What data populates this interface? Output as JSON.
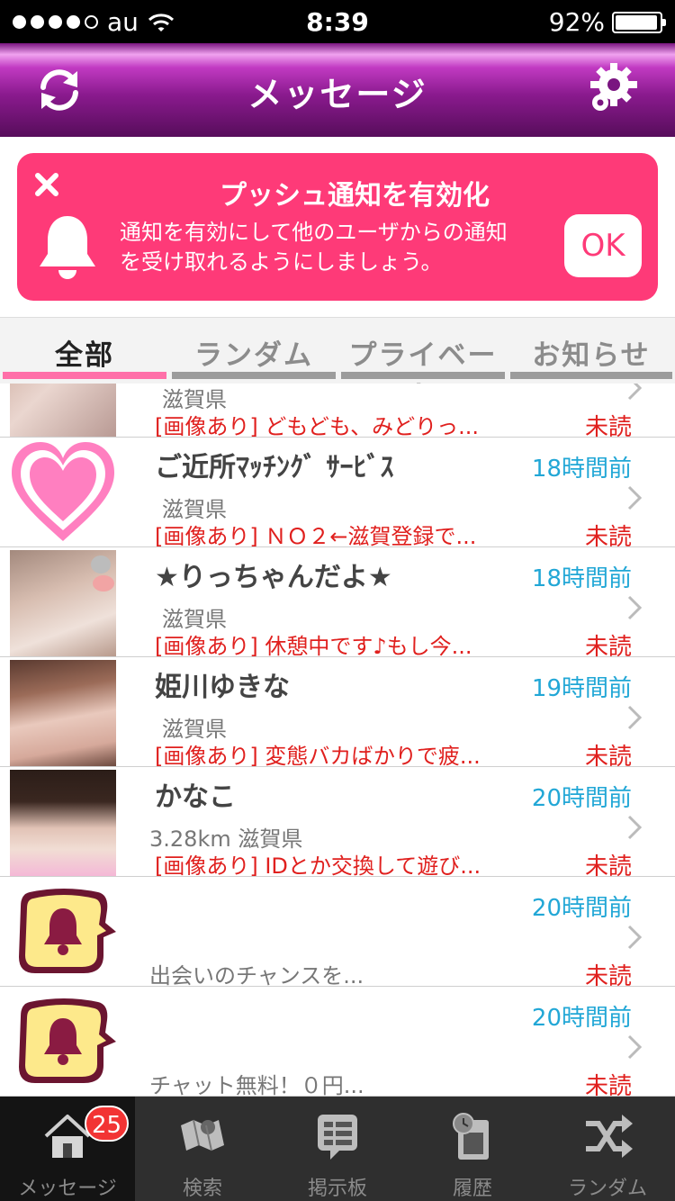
{
  "status_bar": {
    "carrier": "au",
    "time": "8:39",
    "battery": "92%"
  },
  "header": {
    "title": "メッセージ"
  },
  "banner": {
    "title": "プッシュ通知を有効化",
    "text_line1": "通知を有効にして他のユーザからの通知",
    "text_line2": "を受け取れるようにしましょう。",
    "ok_label": "OK"
  },
  "tabs": [
    {
      "label": "全部",
      "active": true
    },
    {
      "label": "ランダム",
      "active": false
    },
    {
      "label": "プライベート",
      "active": false
    },
    {
      "label": "お知らせ",
      "active": false
    }
  ],
  "messages": [
    {
      "name": "",
      "time": "",
      "location": "滋賀県",
      "preview": "[画像あり] どもども、みどりっ...",
      "status": "未読"
    },
    {
      "name": "ご近所ﾏｯﾁﾝｸﾞ ｻｰﾋﾞｽ",
      "time": "18時間前",
      "location": "滋賀県",
      "preview": "[画像あり] ＮＯ２←滋賀登録で...",
      "status": "未読"
    },
    {
      "name": "★りっちゃんだよ★",
      "time": "18時間前",
      "location": "滋賀県",
      "preview": "[画像あり] 休憩中です♪もし今...",
      "status": "未読"
    },
    {
      "name": "姫川ゆきな",
      "time": "19時間前",
      "location": "滋賀県",
      "preview": "[画像あり] 変態バカばかりで疲...",
      "status": "未読"
    },
    {
      "name": "かなこ",
      "time": "20時間前",
      "location": "3.28km  滋賀県",
      "preview": "[画像あり] IDとか交換して遊び...",
      "status": "未読"
    },
    {
      "name": "",
      "time": "20時間前",
      "location": "",
      "preview": "出会いのチャンスを...",
      "status": "未読"
    },
    {
      "name": "",
      "time": "20時間前",
      "location": "",
      "preview": "チャット無料！０円...",
      "status": "未読"
    }
  ],
  "tab_bar": {
    "items": [
      {
        "label": "メッセージ",
        "icon": "home-icon",
        "active": true
      },
      {
        "label": "検索",
        "icon": "map-icon",
        "active": false
      },
      {
        "label": "掲示板",
        "icon": "bulletin-board-icon",
        "active": false
      },
      {
        "label": "履歴",
        "icon": "history-icon",
        "active": false
      },
      {
        "label": "ランダム",
        "icon": "random-icon",
        "active": false
      }
    ],
    "badge": "25"
  },
  "colors": {
    "accent_pink": "#fe3a78",
    "nav_purple": "#8a1a8e",
    "time_blue": "#22a7d6",
    "unread_red": "#e0201e",
    "tab_active": "#ff6fa8"
  }
}
